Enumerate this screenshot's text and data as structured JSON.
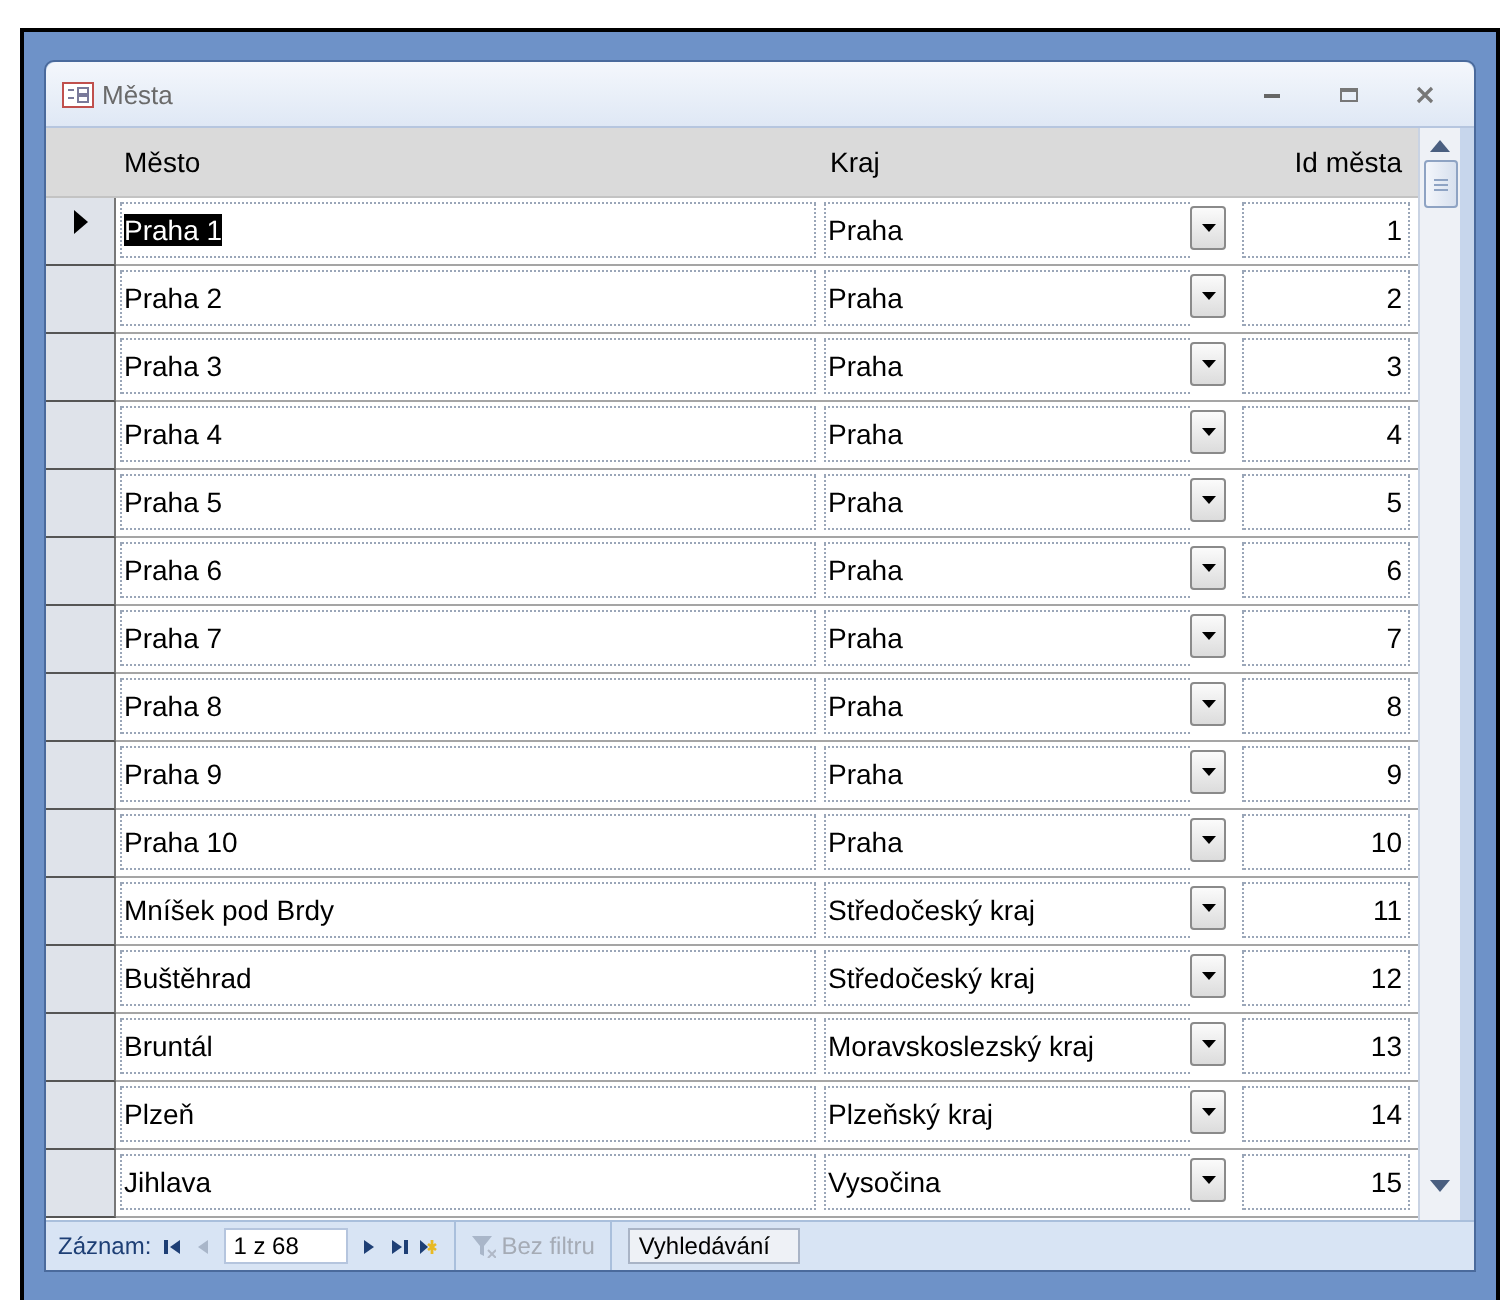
{
  "window": {
    "title": "Města"
  },
  "columns": [
    "Město",
    "Kraj",
    "Id města"
  ],
  "rows": [
    {
      "mesto": "Praha 1",
      "kraj": "Praha",
      "id": "1",
      "selected": true
    },
    {
      "mesto": "Praha 2",
      "kraj": "Praha",
      "id": "2",
      "selected": false
    },
    {
      "mesto": "Praha 3",
      "kraj": "Praha",
      "id": "3",
      "selected": false
    },
    {
      "mesto": "Praha 4",
      "kraj": "Praha",
      "id": "4",
      "selected": false
    },
    {
      "mesto": "Praha 5",
      "kraj": "Praha",
      "id": "5",
      "selected": false
    },
    {
      "mesto": "Praha 6",
      "kraj": "Praha",
      "id": "6",
      "selected": false
    },
    {
      "mesto": "Praha 7",
      "kraj": "Praha",
      "id": "7",
      "selected": false
    },
    {
      "mesto": "Praha 8",
      "kraj": "Praha",
      "id": "8",
      "selected": false
    },
    {
      "mesto": "Praha 9",
      "kraj": "Praha",
      "id": "9",
      "selected": false
    },
    {
      "mesto": "Praha 10",
      "kraj": "Praha",
      "id": "10",
      "selected": false
    },
    {
      "mesto": "Mníšek pod Brdy",
      "kraj": "Středočeský kraj",
      "id": "11",
      "selected": false
    },
    {
      "mesto": "Buštěhrad",
      "kraj": "Středočeský kraj",
      "id": "12",
      "selected": false
    },
    {
      "mesto": "Bruntál",
      "kraj": "Moravskoslezský kraj",
      "id": "13",
      "selected": false
    },
    {
      "mesto": "Plzeň",
      "kraj": "Plzeňský kraj",
      "id": "14",
      "selected": false
    },
    {
      "mesto": "Jihlava",
      "kraj": "Vysočina",
      "id": "15",
      "selected": false
    }
  ],
  "navigation": {
    "label": "Záznam:",
    "position": "1 z 68",
    "filter": "Bez filtru",
    "filter_disabled": true,
    "search_placeholder": "Vyhledávání"
  }
}
